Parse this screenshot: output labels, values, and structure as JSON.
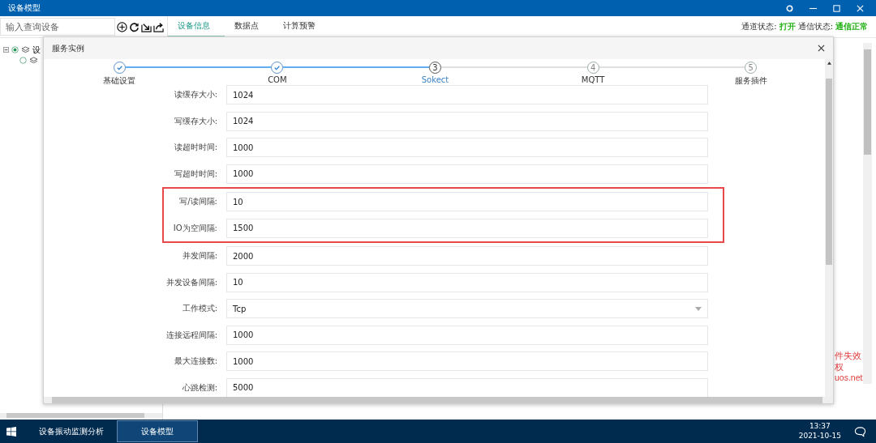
{
  "window": {
    "title": "设备模型"
  },
  "search": {
    "placeholder": "输入查询设备"
  },
  "tabs": [
    {
      "label": "设备信息",
      "selected": true
    },
    {
      "label": "数据点",
      "selected": false
    },
    {
      "label": "计算预警",
      "selected": false
    }
  ],
  "status": [
    {
      "label": "通道状态:",
      "value": "打开"
    },
    {
      "label": "通信状态:",
      "value": "通信正常"
    }
  ],
  "tree": [
    {
      "label": "设",
      "selected": true,
      "expanded": true
    },
    {
      "selected": false
    }
  ],
  "side_notes": [
    "件失效",
    "权",
    "uos.net"
  ],
  "dialog": {
    "title": "服务实例",
    "steps": [
      {
        "label": "基础设置",
        "kind": "done"
      },
      {
        "label": "COM",
        "kind": "done"
      },
      {
        "label": "Sokect",
        "number": "3",
        "kind": "active"
      },
      {
        "label": "MQTT",
        "number": "4",
        "kind": "pending"
      },
      {
        "label": "服务插件",
        "number": "5",
        "kind": "pending"
      }
    ],
    "fields": [
      {
        "label": "读缓存大小:",
        "value": "1024",
        "kind": "text",
        "highlighted": false
      },
      {
        "label": "写缓存大小:",
        "value": "1024",
        "kind": "text",
        "highlighted": false
      },
      {
        "label": "读超时时间:",
        "value": "1000",
        "kind": "text",
        "highlighted": false
      },
      {
        "label": "写超时时间:",
        "value": "1000",
        "kind": "text",
        "highlighted": false
      },
      {
        "label": "写/读间隔:",
        "value": "10",
        "kind": "text",
        "highlighted": true
      },
      {
        "label": "IO为空间隔:",
        "value": "1500",
        "kind": "text",
        "highlighted": true
      },
      {
        "label": "并发间隔:",
        "value": "2000",
        "kind": "text",
        "highlighted": false
      },
      {
        "label": "并发设备间隔:",
        "value": "10",
        "kind": "text",
        "highlighted": false
      },
      {
        "label": "工作模式:",
        "value": "Tcp",
        "kind": "select",
        "highlighted": false
      },
      {
        "label": "连接远程间隔:",
        "value": "1000",
        "kind": "text",
        "highlighted": false
      },
      {
        "label": "最大连接数:",
        "value": "1000",
        "kind": "text",
        "highlighted": false
      },
      {
        "label": "心跳检测:",
        "value": "5000",
        "kind": "text",
        "highlighted": false
      }
    ]
  },
  "taskbar": {
    "apps": [
      {
        "label": "设备振动监测分析",
        "selected": false
      },
      {
        "label": "设备模型",
        "selected": true
      }
    ],
    "time": "13:37",
    "date": "2021-10-15"
  }
}
